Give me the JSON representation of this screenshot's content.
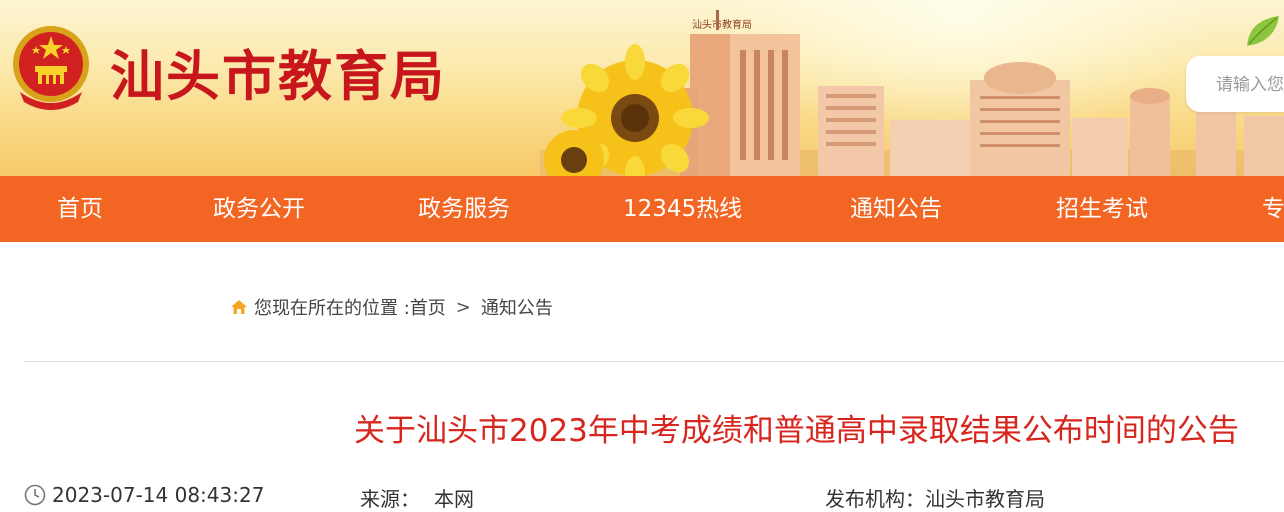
{
  "header": {
    "site_title": "汕头市教育局",
    "building_sign": "汕头市教育局",
    "search_placeholder": "请输入您"
  },
  "nav": {
    "items": [
      "首页",
      "政务公开",
      "政务服务",
      "12345热线",
      "通知公告",
      "招生考试",
      "专"
    ]
  },
  "breadcrumb": {
    "prefix": "您现在所在的位置 : ",
    "home": "首页",
    "separator": ">",
    "current": "通知公告"
  },
  "article": {
    "title": "关于汕头市2023年中考成绩和普通高中录取结果公布时间的公告",
    "datetime": "2023-07-14 08:43:27",
    "source_label": "来源：",
    "source_value": "本网",
    "publisher_label": "发布机构：",
    "publisher_value": "汕头市教育局"
  },
  "colors": {
    "brand_red": "#c8161d",
    "nav_orange": "#f26522",
    "title_red": "#d7261e"
  }
}
